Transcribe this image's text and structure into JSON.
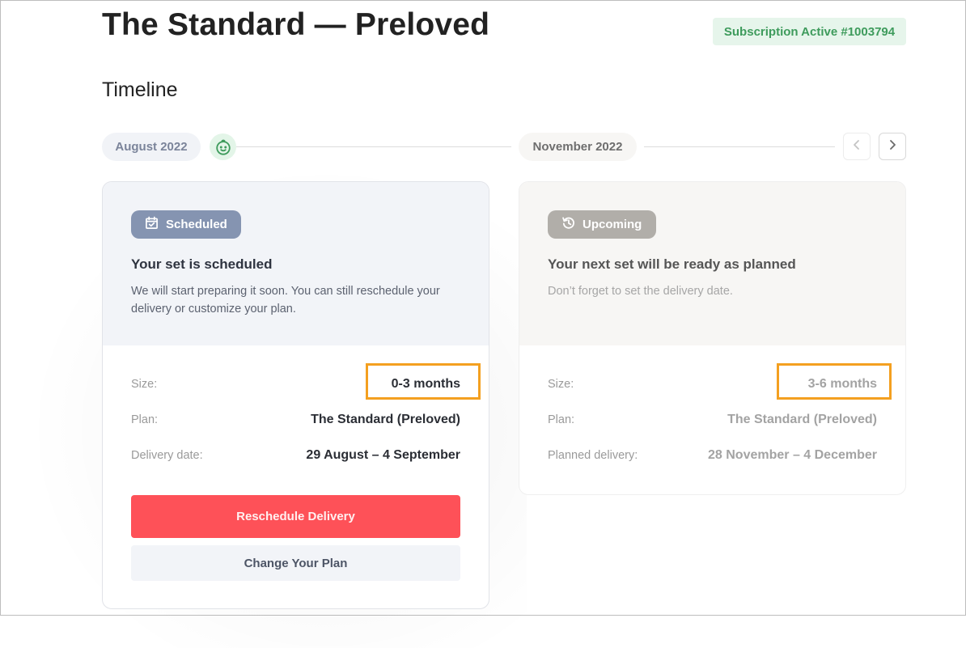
{
  "header": {
    "title": "The Standard — Preloved",
    "subscription_badge": "Subscription Active #1003794"
  },
  "timeline": {
    "section_title": "Timeline",
    "months": [
      {
        "label": "August 2022"
      },
      {
        "label": "November 2022"
      }
    ],
    "current_marker_icon": "baby-face-icon",
    "nav": {
      "prev_icon": "chevron-left-icon",
      "next_icon": "chevron-right-icon"
    }
  },
  "cards": [
    {
      "status": "Scheduled",
      "status_icon": "calendar-check-icon",
      "heading": "Your set is scheduled",
      "description": "We will start preparing it soon. You can still reschedule your delivery or customize your plan.",
      "details": [
        {
          "label": "Size:",
          "value": "0-3 months"
        },
        {
          "label": "Plan:",
          "value": "The Standard (Preloved)"
        },
        {
          "label": "Delivery date:",
          "value": "29 August – 4 September"
        }
      ],
      "actions": {
        "primary": "Reschedule Delivery",
        "secondary": "Change Your Plan"
      }
    },
    {
      "status": "Upcoming",
      "status_icon": "history-icon",
      "heading": "Your next set will be ready as planned",
      "description": "Don’t forget to set the delivery date.",
      "details": [
        {
          "label": "Size:",
          "value": "3-6 months"
        },
        {
          "label": "Plan:",
          "value": "The Standard (Preloved)"
        },
        {
          "label": "Planned delivery:",
          "value": "28 November – 4 December"
        }
      ]
    }
  ],
  "colors": {
    "accent_red": "#fe5158",
    "success_green": "#3e9b5c",
    "scheduled_badge": "#8594b1",
    "upcoming_badge": "#b1aea9",
    "highlight_orange": "#f4a020"
  }
}
